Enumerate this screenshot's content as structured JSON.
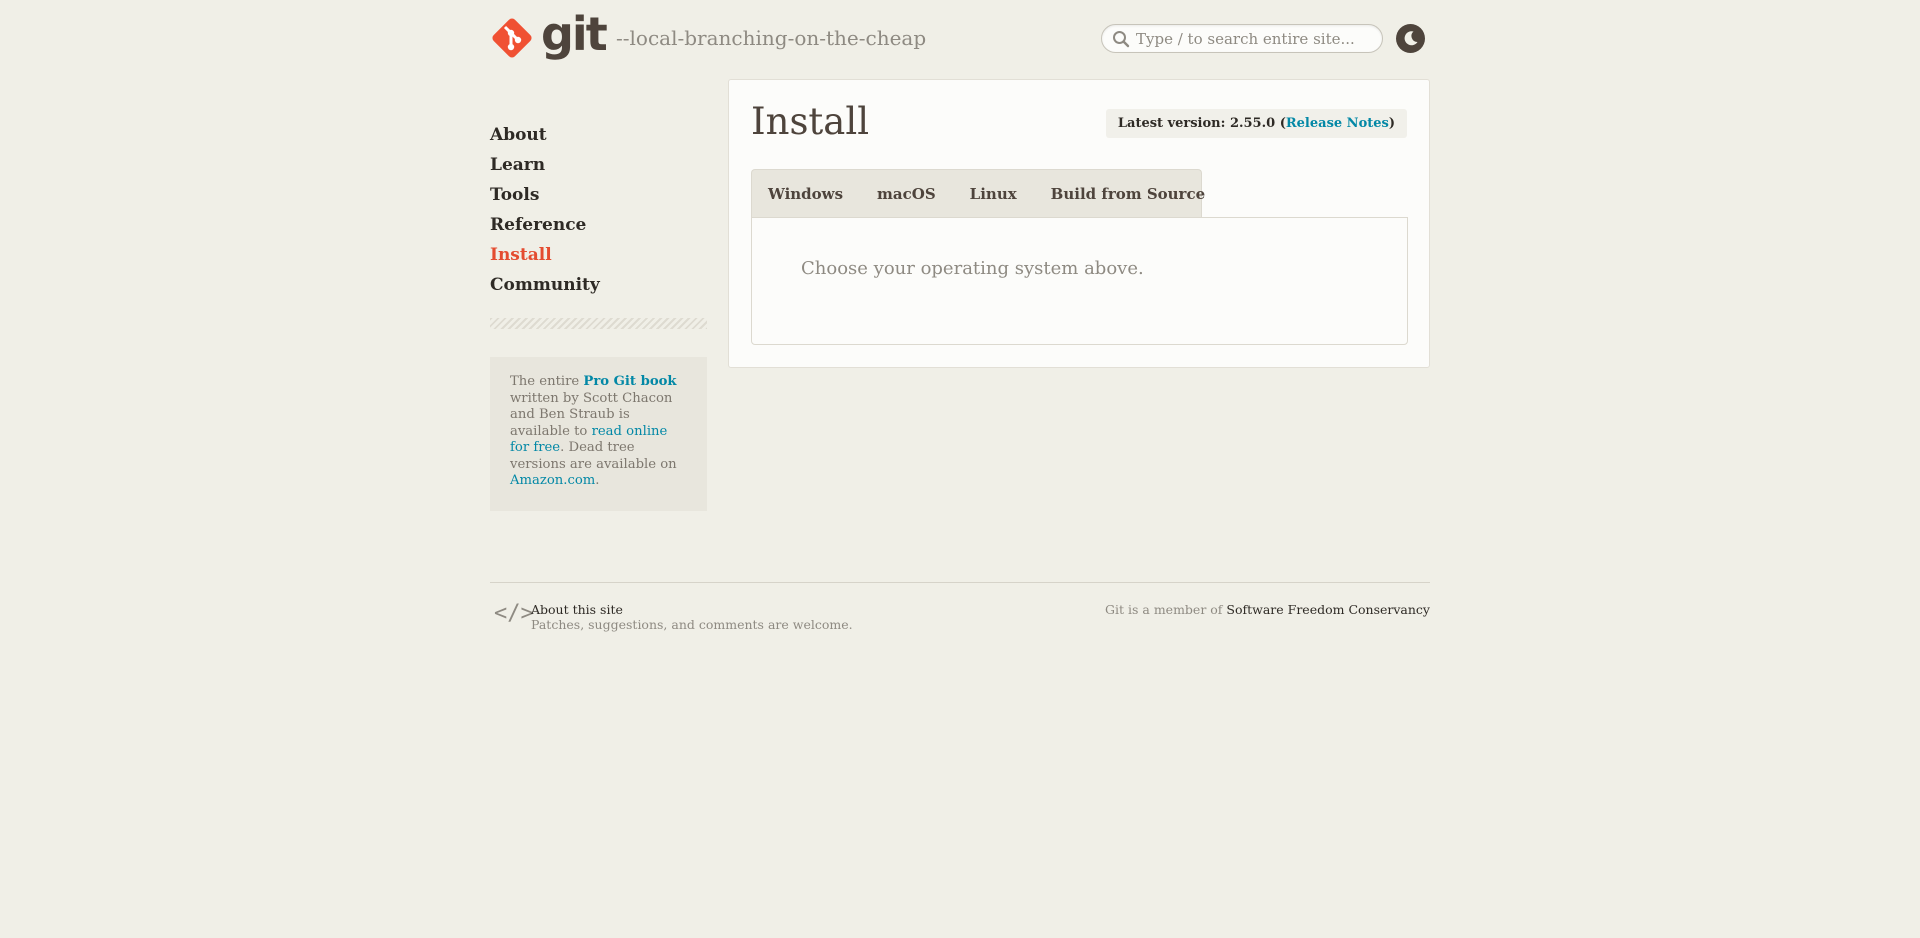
{
  "header": {
    "logo_text": "git",
    "tagline": "--local-branching-on-the-cheap",
    "search": {
      "placeholder": "Type / to search entire site..."
    },
    "icons": {
      "search": "search-icon",
      "theme_toggle": "moon-icon"
    }
  },
  "sidebar": {
    "items": [
      {
        "label": "About"
      },
      {
        "label": "Learn"
      },
      {
        "label": "Tools"
      },
      {
        "label": "Reference"
      },
      {
        "label": "Install",
        "active": true
      },
      {
        "label": "Community"
      }
    ],
    "book": {
      "text_1": "The entire ",
      "book_link": "Pro Git book",
      "text_2": " written by Scott Chacon and Ben Straub is available to ",
      "read_link": "read online for free",
      "text_3": ". Dead tree versions are available on ",
      "amazon_link": "Amazon.com",
      "text_4": "."
    }
  },
  "main": {
    "title": "Install",
    "version": {
      "prefix": "Latest version: 2.55.0 (",
      "release_notes": "Release Notes",
      "suffix": ")"
    },
    "tabs": [
      {
        "label": "Windows"
      },
      {
        "label": "macOS"
      },
      {
        "label": "Linux"
      },
      {
        "label": "Build from Source"
      }
    ],
    "panel_text": "Choose your operating system above."
  },
  "footer": {
    "icon": "</>",
    "about_title": "About this site",
    "about_sub": "Patches, suggestions, and comments are welcome.",
    "member_prefix": "Git is a member of ",
    "member_link": "Software Freedom Conservancy"
  },
  "colors": {
    "background": "#f0efe7",
    "brand": "#f05133",
    "active_nav": "#e44c30",
    "link": "#0388a6",
    "text": "#4e443c"
  }
}
